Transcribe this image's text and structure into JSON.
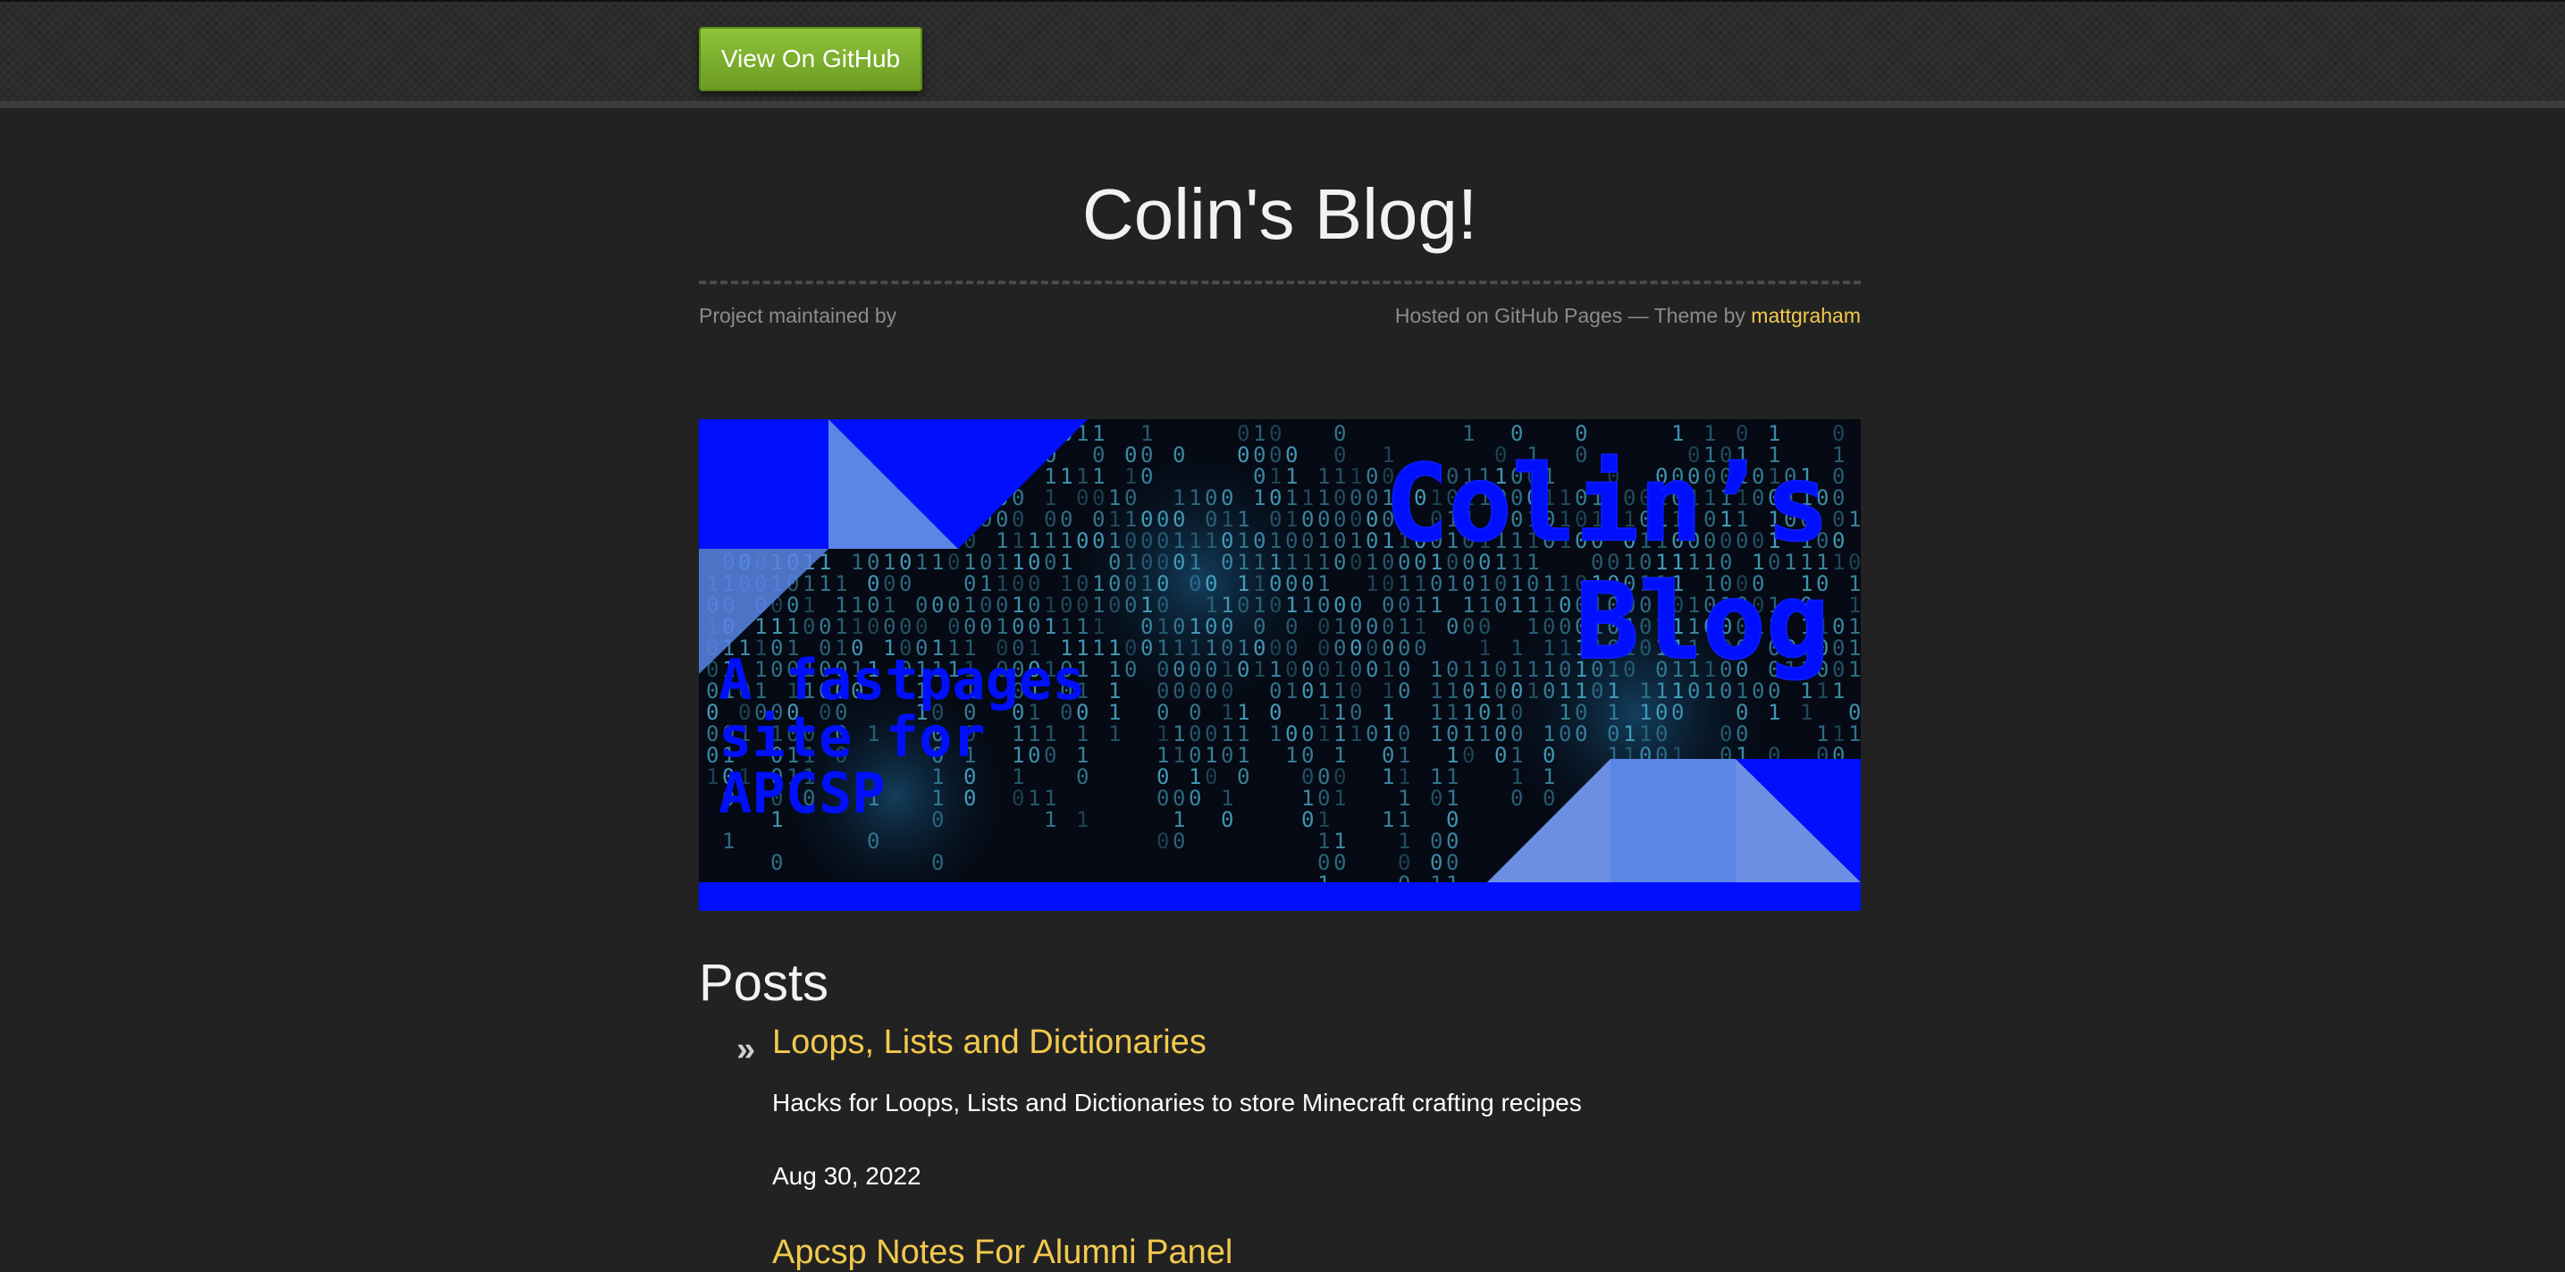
{
  "header": {
    "github_button_label": "View On GitHub"
  },
  "site": {
    "title": "Colin's Blog!",
    "maintained_by": "Project maintained by",
    "hosted_on": "Hosted on GitHub Pages — Theme by",
    "theme_author": "mattgraham"
  },
  "banner": {
    "title_line1": "Colin’s",
    "title_line2": "Blog",
    "subtitle_lines": [
      "A fastpages",
      "site for",
      "APCSP"
    ],
    "colors": {
      "primary_blue": "#0010ff",
      "light_blue": "#5a86e6",
      "code_text": "#4fb6d6",
      "background": "#050a14"
    }
  },
  "posts": {
    "heading": "Posts",
    "items": [
      {
        "title": "Loops, Lists and Dictionaries",
        "description": "Hacks for Loops, Lists and Dictionaries to store Minecraft crafting recipes",
        "date": "Aug 30, 2022"
      },
      {
        "title": "Apcsp Notes For Alumni Panel"
      }
    ]
  },
  "colors": {
    "page_background": "#222222",
    "link": "#f2c94c",
    "button_green": "#7cb02d"
  }
}
